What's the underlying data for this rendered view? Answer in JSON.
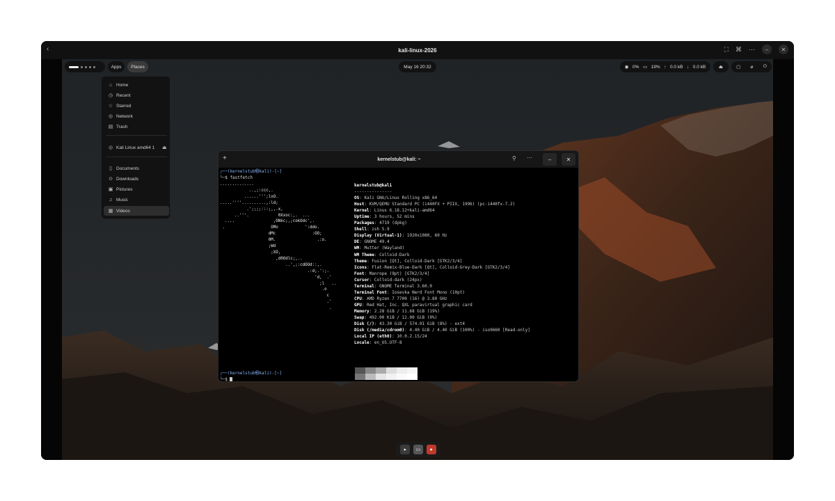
{
  "vm": {
    "title": "kali-linux-2026",
    "back_icon": "chevron-left-icon",
    "controls": [
      "fullscreen-icon",
      "command-icon",
      "more-icon",
      "minimize-icon",
      "close-icon"
    ]
  },
  "topbar": {
    "apps_label": "Apps",
    "places_label": "Places",
    "clock": "May 16  20:32",
    "cpu": "0%",
    "mem": "19%",
    "net_up": "0.0 kB",
    "net_down": "0.0 kB"
  },
  "places": {
    "items": [
      {
        "label": "Home",
        "icon": "home-icon"
      },
      {
        "label": "Recent",
        "icon": "clock-icon"
      },
      {
        "label": "Starred",
        "icon": "star-icon"
      },
      {
        "label": "Network",
        "icon": "network-icon"
      },
      {
        "label": "Trash",
        "icon": "trash-icon"
      }
    ],
    "device": {
      "label": "Kali Linux amd64 1",
      "icon": "disc-icon",
      "eject_icon": "eject-icon"
    },
    "folders": [
      {
        "label": "Documents",
        "icon": "document-icon"
      },
      {
        "label": "Downloads",
        "icon": "download-icon"
      },
      {
        "label": "Pictures",
        "icon": "picture-icon"
      },
      {
        "label": "Music",
        "icon": "music-icon"
      },
      {
        "label": "Videos",
        "icon": "video-icon"
      }
    ]
  },
  "terminal": {
    "title": "kernelstub@kali: ~",
    "prompt_top": "┌──(kernelstub㉿kali)-[~]",
    "command": "└─$ fastfetch",
    "user_host": "kernelstub@kali",
    "underline": "---------------",
    "info": [
      {
        "k": "OS",
        "v": "Kali GNU/Linux Rolling x86_64"
      },
      {
        "k": "Host",
        "v": "KVM/QEMU Standard PC (i440FX + PIIX, 1996) (pc-i440fx-7.2)"
      },
      {
        "k": "Kernel",
        "v": "Linux 6.18.12+kali-amd64"
      },
      {
        "k": "Uptime",
        "v": "3 hours, 52 mins"
      },
      {
        "k": "Packages",
        "v": "4719 (dpkg)"
      },
      {
        "k": "Shell",
        "v": "zsh 5.9"
      },
      {
        "k": "Display (Virtual-1)",
        "v": "1920x1080, 60 Hz"
      },
      {
        "k": "DE",
        "v": "GNOME 49.4"
      },
      {
        "k": "WM",
        "v": "Mutter (Wayland)"
      },
      {
        "k": "WM Theme",
        "v": "Colloid-Dark"
      },
      {
        "k": "Theme",
        "v": "Fusion [Qt], Colloid-Dark [GTK2/3/4]"
      },
      {
        "k": "Icons",
        "v": "Flat-Remix-Blue-Dark [Qt], Colloid-Grey-Dark [GTK2/3/4]"
      },
      {
        "k": "Font",
        "v": "Manrope (9pt) [GTK2/3/4]"
      },
      {
        "k": "Cursor",
        "v": "Colloid-dark (24px)"
      },
      {
        "k": "Terminal",
        "v": "GNOME Terminal 3.60.0"
      },
      {
        "k": "Terminal Font",
        "v": "Iosevka Nerd Font Mono (10pt)"
      },
      {
        "k": "CPU",
        "v": "AMD Ryzen 7 7700 (16) @ 3.80 GHz"
      },
      {
        "k": "GPU",
        "v": "Red Hat, Inc. QXL paravirtual graphic card"
      },
      {
        "k": "Memory",
        "v": "2.28 GiB / 11.68 GiB (19%)"
      },
      {
        "k": "Swap",
        "v": "492.00 KiB / 12.00 GiB (0%)"
      },
      {
        "k": "Disk (/)",
        "v": "43.30 GiB / 574.01 GiB (8%) - ext4"
      },
      {
        "k": "Disk (/media/cdrom0)",
        "v": "4.40 GiB / 4.40 GiB (100%) - iso9660 [Read-only]"
      },
      {
        "k": "Local IP (eth0)",
        "v": "10.0.2.15/24"
      },
      {
        "k": "Locale",
        "v": "en_US.UTF-8"
      }
    ],
    "ascii_art": "..............\n            ..,;:ccc,.\n          ......''';lxO.\n.....''''..........,:ld;\n           .';;;;:::;,,.x,\n      ..'''.            0Xxoc:,.  ...\n  ....                ,ONkc;,;cokOdc',.\n .                   OMo           ':ddo.\n                    dMc               :OO;\n                    0M.                 .:o.\n                    ;Wd\n                     ;XO,\n                       ,d0Odlc;,..\n                           ..',;:cdOOd::,.\n                                    .:d;.':;.\n                                       'd,  .'\n                                         ;l   ..\n                                          .o\n                                            c\n                                            .'\n                                             .",
    "prompt_bottom": "┌──(kernelstub㉿kali)-[~]",
    "cursor_line": "└─$ "
  },
  "dock": {
    "items": [
      "terminal-icon",
      "files-icon",
      "app-icon"
    ]
  }
}
